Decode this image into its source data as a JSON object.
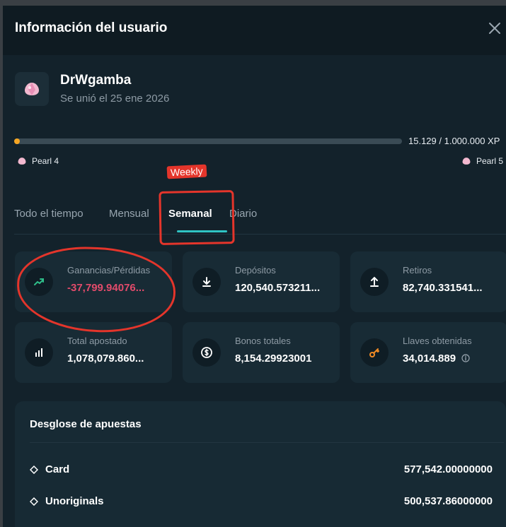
{
  "modal": {
    "title": "Información del usuario",
    "close_icon": "close-icon"
  },
  "user": {
    "name": "DrWgamba",
    "joined": "Se unió el 25 ene 2026",
    "avatar_icon": "pearl-icon"
  },
  "xp": {
    "text": "15.129 / 1.000.000 XP",
    "progress_fraction": 0.015,
    "current_level": "Pearl 4",
    "next_level": "Pearl 5"
  },
  "annotation": {
    "label": "Weekly",
    "color": "#e4352b"
  },
  "tabs": [
    {
      "label": "Todo el tiempo",
      "active": false
    },
    {
      "label": "Mensual",
      "active": false
    },
    {
      "label": "Semanal",
      "active": true
    },
    {
      "label": "Diario",
      "active": false
    }
  ],
  "stats": [
    {
      "label": "Ganancias/Pérdidas",
      "value": "-37,799.94076...",
      "icon": "trend-up-icon",
      "negative": true
    },
    {
      "label": "Depósitos",
      "value": "120,540.573211...",
      "icon": "download-icon"
    },
    {
      "label": "Retiros",
      "value": "82,740.331541...",
      "icon": "upload-icon"
    },
    {
      "label": "Total apostado",
      "value": "1,078,079.860...",
      "icon": "bar-chart-icon"
    },
    {
      "label": "Bonos totales",
      "value": "8,154.29923001",
      "icon": "coin-icon"
    },
    {
      "label": "Llaves obtenidas",
      "value": "34,014.889",
      "icon": "key-icon"
    }
  ],
  "breakdown": {
    "title": "Desglose de apuestas",
    "rows": [
      {
        "name": "Card",
        "value": "577,542.00000000"
      },
      {
        "name": "Unoriginals",
        "value": "500,537.86000000"
      }
    ]
  },
  "colors": {
    "accent": "#2fc4c4",
    "negative": "#e24b6b",
    "xp_fill": "#f5a623"
  }
}
